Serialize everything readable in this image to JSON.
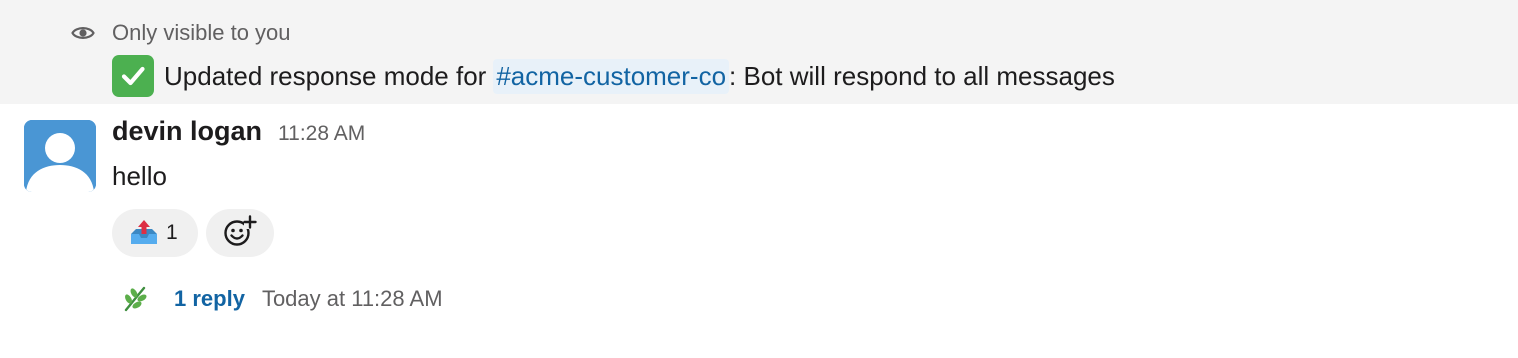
{
  "ephemeral": {
    "visibility_label": "Only visible to you",
    "icon": "eye-icon",
    "check_icon": "white-check-mark-icon",
    "text_prefix": "Updated response mode for",
    "channel": "#acme-customer-co",
    "text_suffix": ": Bot will respond to all messages",
    "background": "#f4f4f4"
  },
  "message": {
    "avatar_icon": "default-user-avatar",
    "author": "devin logan",
    "timestamp": "11:28 AM",
    "text": "hello",
    "reactions": [
      {
        "emoji": "outbox-tray-icon",
        "count": "1"
      }
    ],
    "add_reaction_icon": "add-reaction-icon"
  },
  "thread": {
    "avatar_icon": "herb-icon",
    "reply_label": "1 reply",
    "last_reply": "Today at 11:28 AM",
    "link_color": "#1264a3"
  }
}
